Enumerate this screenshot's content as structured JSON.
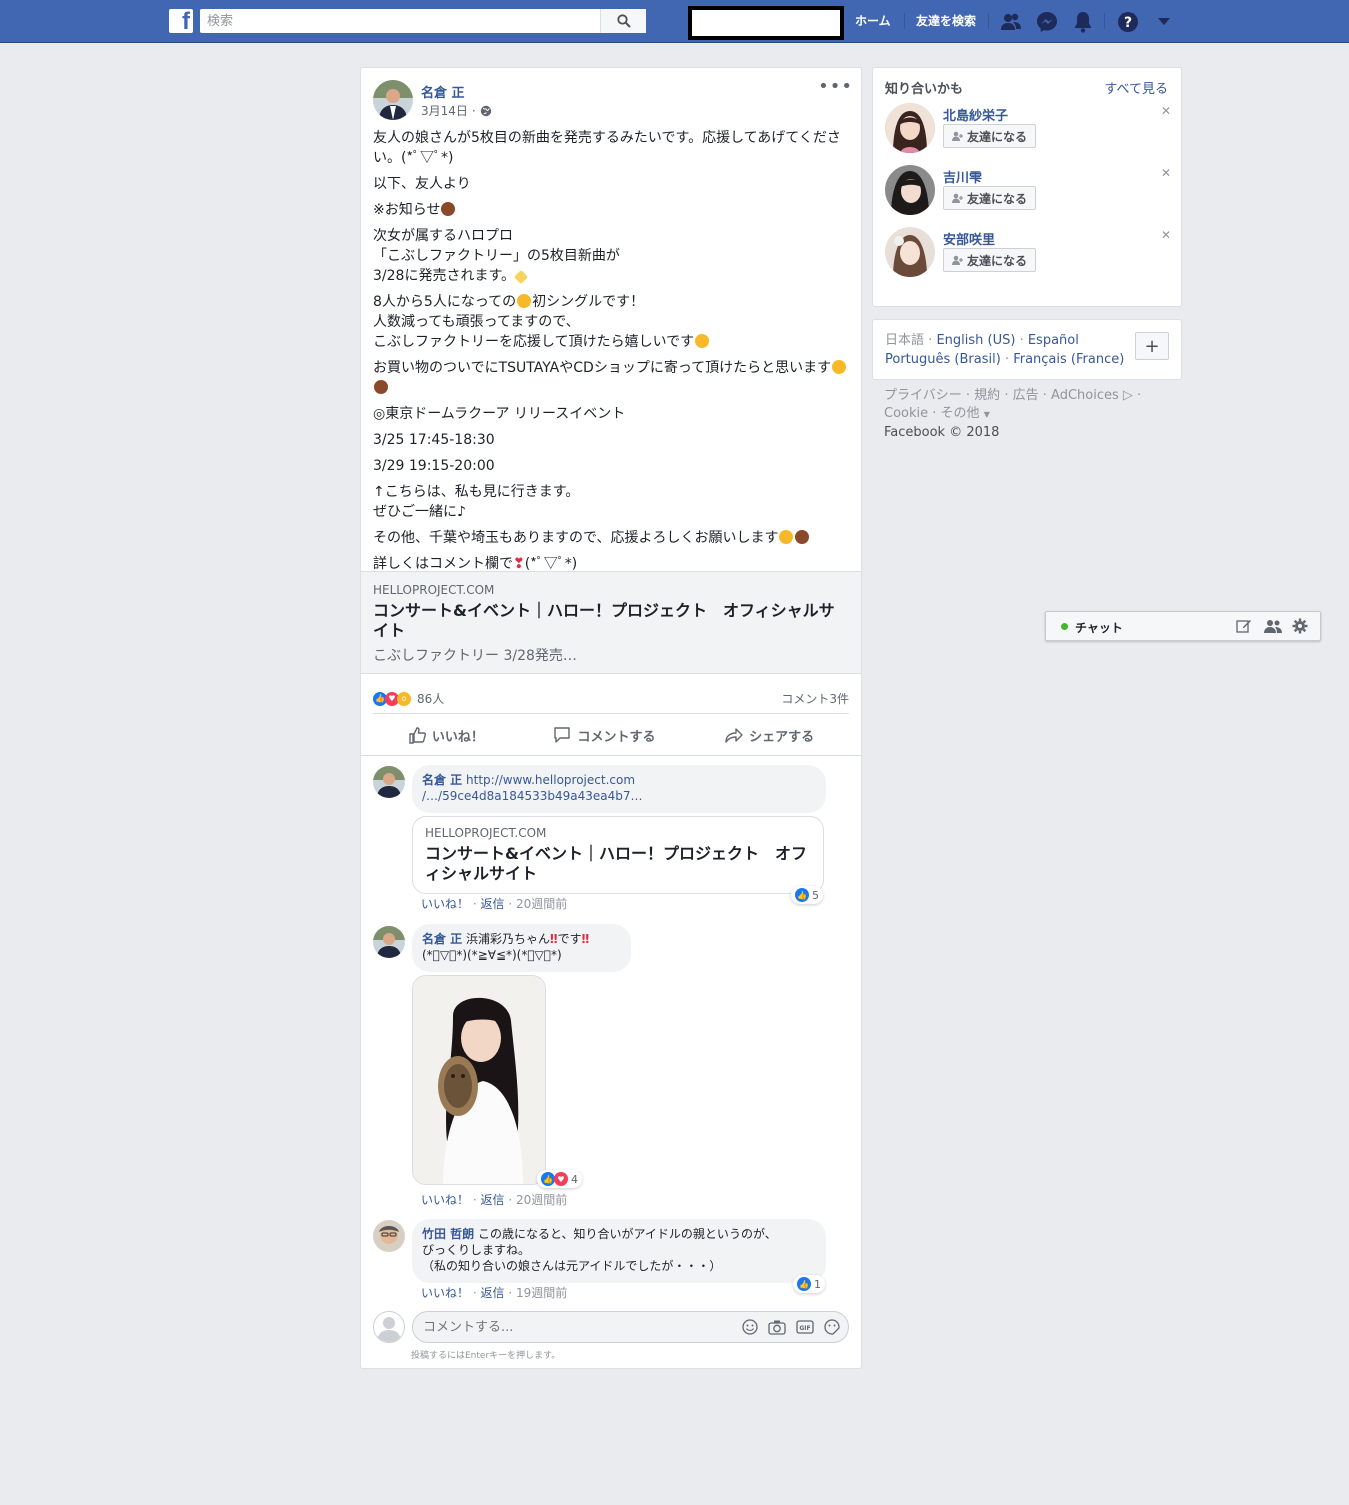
{
  "topbar": {
    "logo": "f",
    "search_placeholder": "検索",
    "nav_home": "ホーム",
    "nav_find_friends": "友達を検索",
    "icons": [
      "friends-icon",
      "messenger-icon",
      "notifications-icon",
      "help-icon",
      "dropdown-icon"
    ],
    "brand_color": "#4267b2"
  },
  "post": {
    "author": "名倉 正",
    "date": "3月14日",
    "audience_sep": "·",
    "text": [
      "友人の娘さんが5枚目の新曲を発売するみたいです。応援してあげてくださ\nい。(*ﾟ▽ﾟ*)",
      "以下、友人より",
      "※お知らせ",
      "次女が属するハロプロ\n「こぶしファクトリー」の5枚目新曲が\n3/28に発売されます。",
      "8人から5人になっての",
      "初シングルです！\n人数減っても頑張ってますので、\nこぶしファクトリーを応援して頂けたら嬉しいです",
      "お買い物のついでにTSUTAYAやCDショップに寄って頂けたらと思います",
      "◎東京ドームラクーア リリースイベント",
      "3/25 17:45-18:30",
      "3/29 19:15-20:00",
      "↑こちらは、私も見に行きます。\nぜひご一緒に♪",
      "その他、千葉や埼玉もありますので、応援よろしくお願いします",
      "詳しくはコメント欄で",
      "(*ﾟ▽ﾟ*)"
    ],
    "link_preview": {
      "domain": "HELLOPROJECT.COM",
      "title": "コンサート&イベント｜ハロー！プロジェクト　オフィシャルサイト",
      "description": "こぶしファクトリー 3/28発売…"
    },
    "reactions_count": "86人",
    "comments_count": "コメント3件",
    "actions": {
      "like": "いいね！",
      "comment": "コメントする",
      "share": "シェアする"
    }
  },
  "comments": [
    {
      "author": "名倉 正",
      "text_link_1": "http://www.helloproject.com",
      "text_link_2": "/…/59ce4d8a184533b49a43ea4b7…",
      "preview_domain": "HELLOPROJECT.COM",
      "preview_title": "コンサート&イベント｜ハロー！プロジェクト　オフィシャルサイト",
      "like_label": "いいね！",
      "reply_label": "返信",
      "sep": "·",
      "time": "20週間前",
      "likes": "5"
    },
    {
      "author": "名倉 正",
      "text_1": "浜浦彩乃ちゃん",
      "text_2": "です",
      "text_3": "(*ﾟ▽ﾟ*)(*≧∀≦*)(*ﾟ▽ﾟ*)",
      "like_label": "いいね！",
      "reply_label": "返信",
      "sep": "·",
      "time": "20週間前",
      "likes": "4"
    },
    {
      "author": "竹田 哲朗",
      "text": "この歳になると、知り合いがアイドルの親というのが、\nびっくりしますね。\n（私の知り合いの娘さんは元アイドルでしたが・・・）",
      "like_label": "いいね！",
      "reply_label": "返信",
      "sep": "·",
      "time": "19週間前",
      "likes": "1"
    }
  ],
  "comment_input": {
    "placeholder": "コメントする...",
    "hint": "投稿するにはEnterキーを押します。"
  },
  "pymk": {
    "title": "知り合いかも",
    "see_all": "すべて見る",
    "people": [
      {
        "name": "北島紗栄子",
        "button": "友達になる"
      },
      {
        "name": "吉川雫",
        "button": "友達になる"
      },
      {
        "name": "安部咲里",
        "button": "友達になる"
      }
    ]
  },
  "languages": {
    "line1": [
      "日本語",
      "English (US)",
      "Español"
    ],
    "line2": [
      "Português (Brasil)",
      "Français (France)"
    ],
    "sep": "·"
  },
  "footer": {
    "privacy": "プライバシー",
    "terms": "規約",
    "ads": "広告",
    "adchoices": "AdChoices",
    "cookie": "Cookie",
    "more": "その他",
    "copyright": "Facebook © 2018",
    "sep": "·"
  },
  "chat": {
    "label": "チャット",
    "status_color": "#42b72a"
  }
}
